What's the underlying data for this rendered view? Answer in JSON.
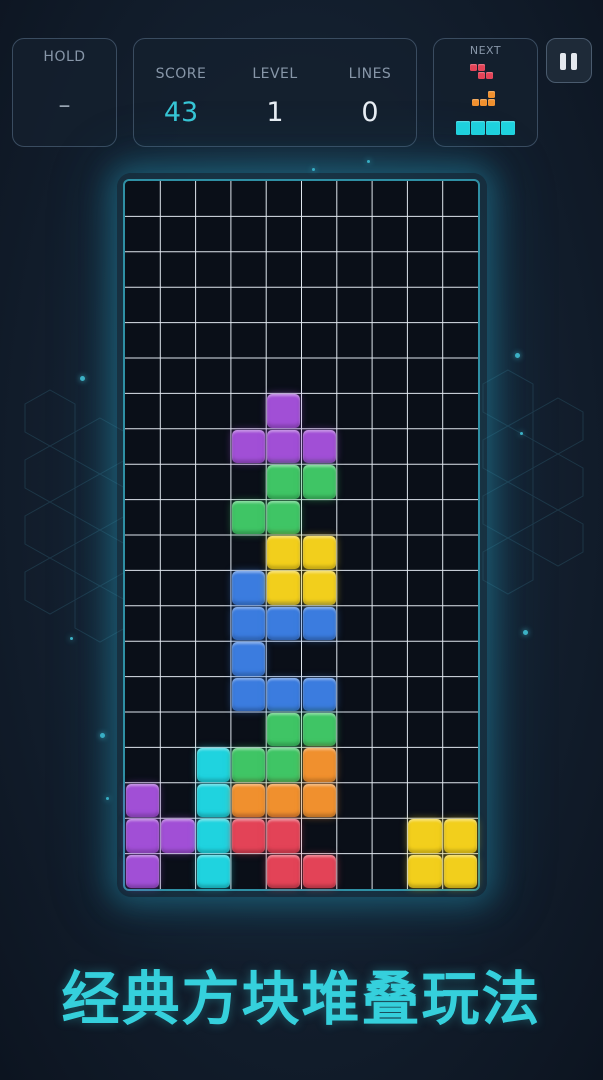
{
  "hold": {
    "label": "HOLD",
    "value": "–"
  },
  "stats": [
    {
      "label": "SCORE",
      "value": "43"
    },
    {
      "label": "LEVEL",
      "value": "1"
    },
    {
      "label": "LINES",
      "value": "0"
    }
  ],
  "next": {
    "label": "NEXT"
  },
  "slogan": "经典方块堆叠玩法",
  "colors": {
    "purple": "#a14fd6",
    "green": "#3fc565",
    "yellow": "#f2cf1c",
    "blue": "#3b7cdf",
    "cyan": "#1fd3df",
    "orange": "#f0902e",
    "red": "#e34357"
  },
  "board": {
    "columns": 10,
    "rows": 20,
    "cells": [
      {
        "row": 6,
        "col": 4,
        "color": "purple"
      },
      {
        "row": 7,
        "col": 3,
        "color": "purple"
      },
      {
        "row": 7,
        "col": 4,
        "color": "purple"
      },
      {
        "row": 7,
        "col": 5,
        "color": "purple"
      },
      {
        "row": 8,
        "col": 4,
        "color": "green"
      },
      {
        "row": 8,
        "col": 5,
        "color": "green"
      },
      {
        "row": 9,
        "col": 3,
        "color": "green"
      },
      {
        "row": 9,
        "col": 4,
        "color": "green"
      },
      {
        "row": 10,
        "col": 4,
        "color": "yellow"
      },
      {
        "row": 10,
        "col": 5,
        "color": "yellow"
      },
      {
        "row": 11,
        "col": 3,
        "color": "blue"
      },
      {
        "row": 11,
        "col": 4,
        "color": "yellow"
      },
      {
        "row": 11,
        "col": 5,
        "color": "yellow"
      },
      {
        "row": 12,
        "col": 3,
        "color": "blue"
      },
      {
        "row": 12,
        "col": 4,
        "color": "blue"
      },
      {
        "row": 12,
        "col": 5,
        "color": "blue"
      },
      {
        "row": 13,
        "col": 3,
        "color": "blue"
      },
      {
        "row": 14,
        "col": 3,
        "color": "blue"
      },
      {
        "row": 14,
        "col": 4,
        "color": "blue"
      },
      {
        "row": 14,
        "col": 5,
        "color": "blue"
      },
      {
        "row": 15,
        "col": 4,
        "color": "green"
      },
      {
        "row": 15,
        "col": 5,
        "color": "green"
      },
      {
        "row": 16,
        "col": 2,
        "color": "cyan"
      },
      {
        "row": 16,
        "col": 3,
        "color": "green"
      },
      {
        "row": 16,
        "col": 4,
        "color": "green"
      },
      {
        "row": 16,
        "col": 5,
        "color": "orange"
      },
      {
        "row": 17,
        "col": 0,
        "color": "purple"
      },
      {
        "row": 17,
        "col": 2,
        "color": "cyan"
      },
      {
        "row": 17,
        "col": 3,
        "color": "orange"
      },
      {
        "row": 17,
        "col": 4,
        "color": "orange"
      },
      {
        "row": 17,
        "col": 5,
        "color": "orange"
      },
      {
        "row": 18,
        "col": 0,
        "color": "purple"
      },
      {
        "row": 18,
        "col": 1,
        "color": "purple"
      },
      {
        "row": 18,
        "col": 2,
        "color": "cyan"
      },
      {
        "row": 18,
        "col": 3,
        "color": "red"
      },
      {
        "row": 18,
        "col": 4,
        "color": "red"
      },
      {
        "row": 18,
        "col": 8,
        "color": "yellow"
      },
      {
        "row": 18,
        "col": 9,
        "color": "yellow"
      },
      {
        "row": 19,
        "col": 0,
        "color": "purple"
      },
      {
        "row": 19,
        "col": 2,
        "color": "cyan"
      },
      {
        "row": 19,
        "col": 4,
        "color": "red"
      },
      {
        "row": 19,
        "col": 5,
        "color": "red"
      },
      {
        "row": 19,
        "col": 8,
        "color": "yellow"
      },
      {
        "row": 19,
        "col": 9,
        "color": "yellow"
      }
    ]
  },
  "next_pieces": [
    {
      "shape": "Z",
      "color": "red",
      "cells": [
        [
          0,
          0
        ],
        [
          0,
          1
        ],
        [
          1,
          1
        ],
        [
          1,
          2
        ]
      ]
    },
    {
      "shape": "L",
      "color": "orange",
      "cells": [
        [
          0,
          2
        ],
        [
          1,
          0
        ],
        [
          1,
          1
        ],
        [
          1,
          2
        ]
      ]
    },
    {
      "shape": "I",
      "color": "cyan",
      "cells": [
        [
          0,
          0
        ],
        [
          0,
          1
        ],
        [
          0,
          2
        ],
        [
          0,
          3
        ]
      ]
    }
  ]
}
